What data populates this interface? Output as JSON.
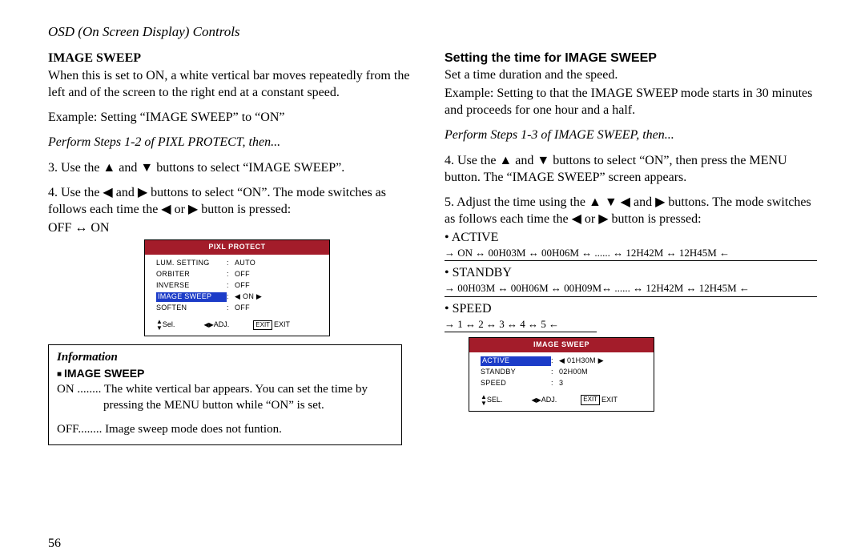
{
  "header": "OSD (On Screen Display) Controls",
  "left": {
    "h1": "IMAGE SWEEP",
    "p1": "When this is set to ON, a white vertical bar moves repeatedly from the left and of the screen to the right end at a constant speed.",
    "p2": "Example: Setting “IMAGE SWEEP” to “ON”",
    "p3": "Perform Steps 1-2 of PIXL PROTECT, then...",
    "p4": "3. Use the ▲ and ▼ buttons to select “IMAGE SWEEP”.",
    "p5": "4. Use the ◀ and ▶ buttons to select “ON”. The mode switches as follows each time the ◀ or ▶ button is pressed:",
    "p6": "OFF ↔ ON",
    "info_title": "Information",
    "info_h": "IMAGE SWEEP",
    "info_on": "ON ........ The white vertical bar appears.  You can set the time by pressing the MENU button while “ON” is set.",
    "info_off": "OFF........ Image sweep mode does not funtion."
  },
  "right": {
    "h1": "Setting the time for IMAGE SWEEP",
    "p1": "Set a time duration and the speed.",
    "p2": "Example: Setting to that the IMAGE SWEEP mode starts in 30 minutes and proceeds for one hour and a half.",
    "p3": "Perform Steps 1-3 of IMAGE SWEEP, then...",
    "p4": "4. Use the ▲ and ▼ buttons to select “ON”, then press the MENU button. The “IMAGE SWEEP” screen appears.",
    "p5": "5. Adjust the time using the ▲ ▼ ◀ and ▶ buttons. The mode switches as follows each time the ◀ or ▶ button is pressed:",
    "active_label": "• ACTIVE",
    "active_cycle": "→ ON ↔ 00H03M ↔ 00H06M ↔ ...... ↔ 12H42M ↔  12H45M ←",
    "standby_label": "• STANDBY",
    "standby_cycle": "→ 00H03M ↔ 00H06M ↔ 00H09M↔ ...... ↔ 12H42M ↔ 12H45M ←",
    "speed_label": "• SPEED",
    "speed_cycle": "→ 1 ↔ 2 ↔ 3  ↔ 4 ↔ 5 ←"
  },
  "osd1": {
    "title": "PIXL PROTECT",
    "rows": [
      {
        "label": "LUM. SETTING",
        "val": "AUTO"
      },
      {
        "label": "ORBITER",
        "val": "OFF"
      },
      {
        "label": "INVERSE",
        "val": "OFF"
      },
      {
        "label": "IMAGE SWEEP",
        "val": "◀  ON  ▶",
        "sel": true
      },
      {
        "label": "SOFTEN",
        "val": "OFF"
      }
    ],
    "sel": "Sel.",
    "adj": "ADJ.",
    "exit1": "EXIT",
    "exit2": "EXIT"
  },
  "osd2": {
    "title": "IMAGE SWEEP",
    "rows": [
      {
        "label": "ACTIVE",
        "val": "◀ 01H30M ▶",
        "sel": true
      },
      {
        "label": "STANDBY",
        "val": "02H00M"
      },
      {
        "label": "SPEED",
        "val": "3"
      }
    ],
    "sel": "SEL.",
    "adj": "ADJ.",
    "exit1": "EXIT",
    "exit2": "EXIT"
  },
  "pagenum": "56"
}
